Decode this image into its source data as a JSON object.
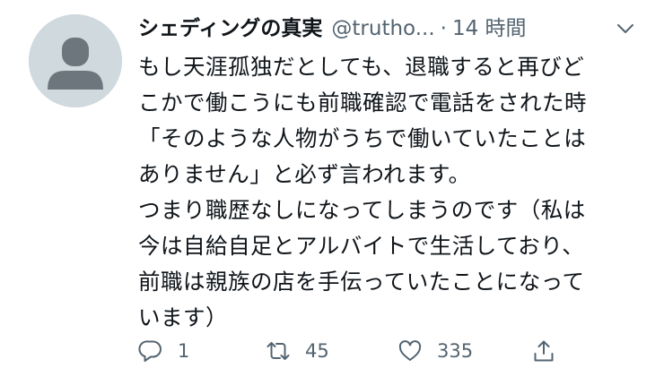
{
  "tweet": {
    "display_name": "シェディングの真実",
    "handle": "@trutho...",
    "separator": "·",
    "time": "14 時間",
    "lines": [
      "もし天涯孤独だとしても、退職すると再びど",
      "こかで働こうにも前職確認で電話をされた時",
      "「そのような人物がうちで働いていたことは",
      "ありません」と必ず言われます。",
      "つまり職歴なしになってしまうのです（私は",
      "今は自給自足とアルバイトで生活しており、",
      "前職は親族の店を手伝っていたことになって",
      "います）"
    ]
  },
  "actions": {
    "reply": {
      "icon": "reply-icon",
      "count": "1"
    },
    "retweet": {
      "icon": "retweet-icon",
      "count": "45"
    },
    "like": {
      "icon": "heart-icon",
      "count": "335"
    },
    "share": {
      "icon": "share-icon"
    }
  },
  "colors": {
    "text": "#0f1419",
    "secondary": "#536471",
    "avatar_bg": "#cfd9de",
    "avatar_fg": "#6e767d"
  }
}
